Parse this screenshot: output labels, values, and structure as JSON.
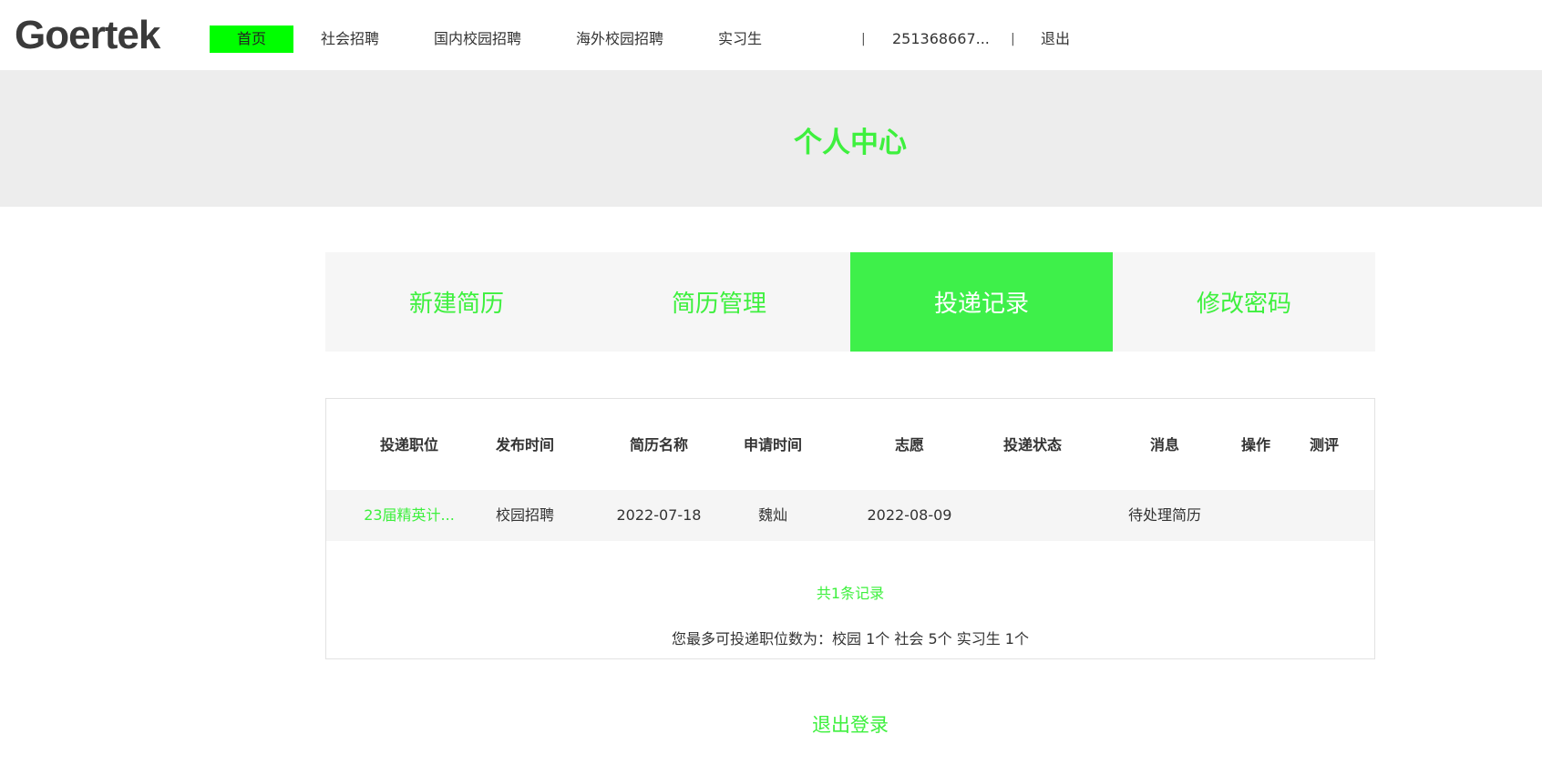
{
  "header": {
    "logo_text": "Goertek",
    "nav": {
      "home": "首页",
      "social": "社会招聘",
      "domestic_campus": "国内校园招聘",
      "overseas_campus": "海外校园招聘",
      "intern": "实习生"
    },
    "separator": "|",
    "user_id": "251368667...",
    "logout": "退出"
  },
  "banner": {
    "title": "个人中心"
  },
  "tabs": [
    {
      "label": "新建简历",
      "active": false
    },
    {
      "label": "简历管理",
      "active": false
    },
    {
      "label": "投递记录",
      "active": true
    },
    {
      "label": "修改密码",
      "active": false
    }
  ],
  "table": {
    "headers": [
      "投递职位",
      "发布时间",
      "简历名称",
      "申请时间",
      "志愿",
      "投递状态",
      "消息",
      "操作",
      "测评"
    ],
    "rows": [
      {
        "position": "23届精英计...",
        "publish": "校园招聘",
        "resume": "2022-07-18",
        "applicant": "魏灿",
        "apply_date": "2022-08-09",
        "volunteer": "",
        "status": "待处理简历",
        "message": "",
        "action": ""
      }
    ]
  },
  "total_records": "共1条记录",
  "quota_note": "您最多可投递职位数为：校园 1个 社会 5个 实习生 1个",
  "logout_login": "退出登录",
  "colors": {
    "accent": "#3ef03e",
    "active_tab": "#3ef04a",
    "home_highlight": "#00ff00",
    "banner_bg": "#ededed"
  }
}
